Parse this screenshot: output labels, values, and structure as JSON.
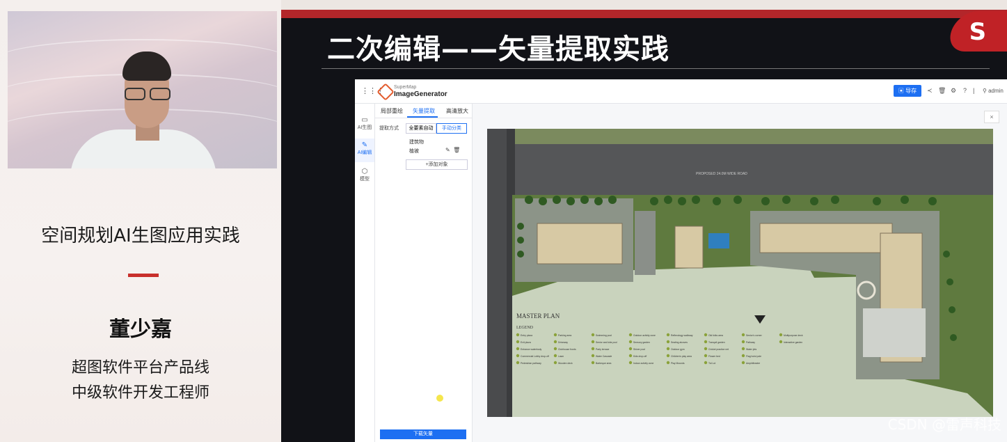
{
  "speaker_panel": {
    "talk_title": "空间规划AI生图应用实践",
    "name": "董少嘉",
    "role_line1": "超图软件平台产品线",
    "role_line2": "中级软件开发工程师"
  },
  "slide": {
    "title": "二次编辑——矢量提取实践",
    "logo_text": "S"
  },
  "app": {
    "brand_small": "SuperMap",
    "brand": "ImageGenerator",
    "export_label": "导存",
    "user": "admin",
    "sidebar": [
      {
        "label": "AI生图",
        "icon": "image-icon"
      },
      {
        "label": "AI编辑",
        "icon": "edit-icon"
      },
      {
        "label": "模型",
        "icon": "model-icon"
      }
    ],
    "tabs": [
      "局部重绘",
      "矢量提取",
      "高清放大"
    ],
    "active_tab": "矢量提取",
    "extract_method_label": "提取方式",
    "methods": [
      "全要素自动",
      "手动分类"
    ],
    "active_method": "手动分类",
    "objects": [
      "建筑物",
      "植被"
    ],
    "add_object": "+添加对象",
    "download": "下载矢量",
    "close": "×"
  },
  "plan": {
    "title": "MASTER PLAN",
    "legend": "LEGEND",
    "road_label": "PROPOSED 24.0M WIDE ROAD",
    "legend_items": [
      "Entry plaza",
      "Exit plaza",
      "Entrance waterbody",
      "Commercial Lobby drop-off",
      "Pedestrian pathway",
      "Parking area",
      "Driveway",
      "Clubhouse fronts",
      "Lawn",
      "Wooden deck",
      "Swimming pool",
      "Senior and kids pool",
      "Party terrace",
      "Water Cascade",
      "Barbeque area",
      "Outdoor activity zone",
      "Sensory garden",
      "Shiver pool",
      "Kids drop-off",
      "Indoor activity zone",
      "Reflexology walkway",
      "Seating alcoves",
      "Outdoor gym",
      "Children's play area",
      "Play Mounds",
      "Old folks area",
      "Tranquil garden",
      "Cricket practice net",
      "Flower bed",
      "Tot Lot",
      "Senior's corner",
      "Pathway",
      "Water jets",
      "Flag hoist pole",
      "Amphitheatre",
      "Multipurpose deck",
      "Interactive garden"
    ]
  },
  "watermark": "CSDN @雷声科技"
}
